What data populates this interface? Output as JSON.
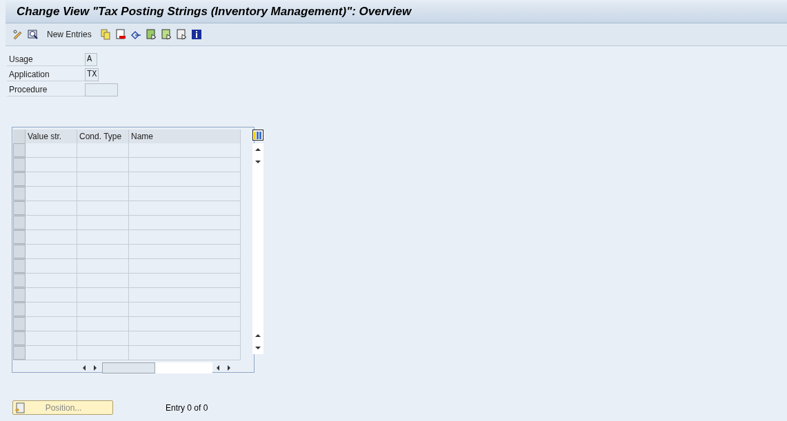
{
  "window": {
    "title": "Change View \"Tax Posting Strings (Inventory Management)\": Overview"
  },
  "toolbar": {
    "new_entries": "New Entries"
  },
  "fields": [
    {
      "label": "Usage",
      "value": "A",
      "kind": "small"
    },
    {
      "label": "Application",
      "value": "TX",
      "kind": "small"
    },
    {
      "label": "Procedure",
      "kind": "wide"
    }
  ],
  "table": {
    "columns": [
      "Value str.",
      "Cond. Type",
      "Name"
    ]
  },
  "footer": {
    "position_button": {
      "label": "Position...",
      "disabled": true
    },
    "entry_count": "Entry 0 of 0"
  }
}
